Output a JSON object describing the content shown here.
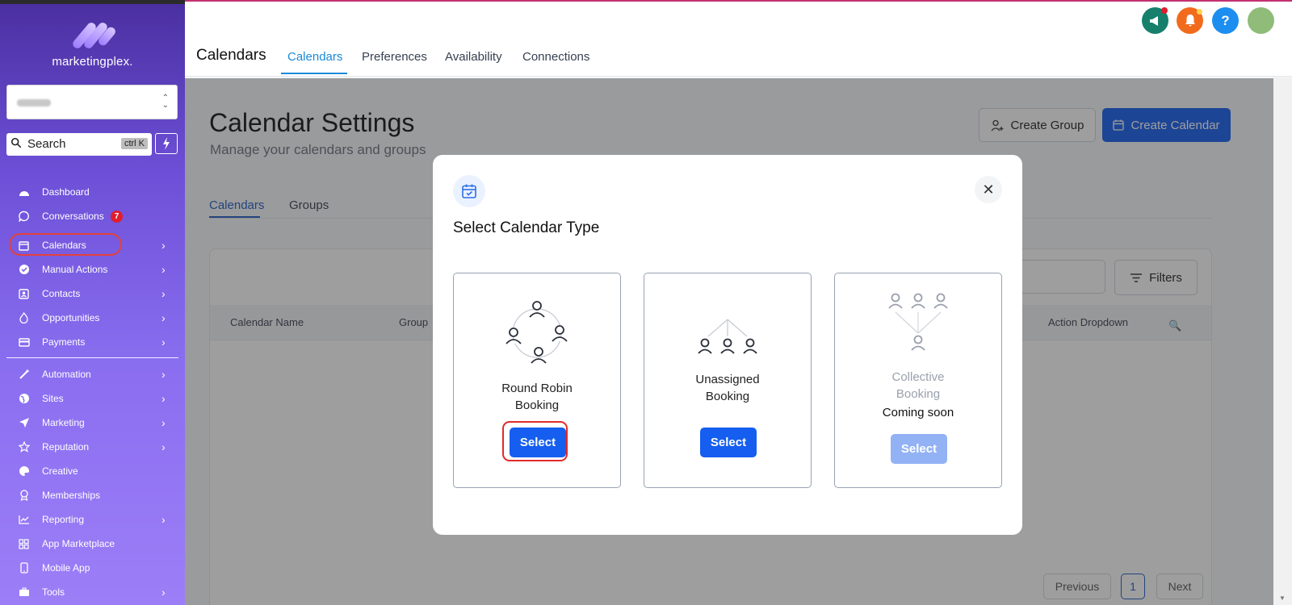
{
  "sidebar": {
    "brand": "marketingplex.",
    "search_label": "Search",
    "search_shortcut": "ctrl K",
    "items": [
      {
        "label": "Dashboard",
        "icon": "dashboard-icon"
      },
      {
        "label": "Conversations",
        "icon": "chat-icon",
        "badge": "7"
      },
      {
        "label": "Calendars",
        "icon": "calendar-icon"
      },
      {
        "label": "Manual Actions",
        "icon": "check-circle-icon"
      },
      {
        "label": "Contacts",
        "icon": "contacts-icon"
      },
      {
        "label": "Opportunities",
        "icon": "flame-icon"
      },
      {
        "label": "Payments",
        "icon": "card-icon"
      },
      {
        "label": "Automation",
        "icon": "wand-icon"
      },
      {
        "label": "Sites",
        "icon": "globe-icon"
      },
      {
        "label": "Marketing",
        "icon": "send-icon"
      },
      {
        "label": "Reputation",
        "icon": "star-icon"
      },
      {
        "label": "Creative",
        "icon": "palette-icon"
      },
      {
        "label": "Memberships",
        "icon": "award-icon"
      },
      {
        "label": "Reporting",
        "icon": "chart-icon"
      },
      {
        "label": "App Marketplace",
        "icon": "grid-icon"
      },
      {
        "label": "Mobile App",
        "icon": "phone-icon"
      },
      {
        "label": "Tools",
        "icon": "toolbox-icon"
      }
    ]
  },
  "topbar": {
    "title": "Calendars",
    "tabs": [
      "Calendars",
      "Preferences",
      "Availability",
      "Connections"
    ],
    "active_tab": "Calendars"
  },
  "main": {
    "title": "Calendar Settings",
    "subtitle": "Manage your calendars and groups",
    "create_group_label": "Create Group",
    "create_calendar_label": "Create Calendar",
    "sub_tabs": [
      "Calendars",
      "Groups"
    ],
    "filters_label": "Filters",
    "columns": [
      "Calendar Name",
      "Group",
      "Action Dropdown"
    ],
    "pager": {
      "previous": "Previous",
      "page": "1",
      "next": "Next"
    }
  },
  "modal": {
    "title": "Select Calendar Type",
    "cards": [
      {
        "name_line1": "Round Robin",
        "name_line2": "Booking",
        "button": "Select",
        "subtitle": ""
      },
      {
        "name_line1": "Unassigned",
        "name_line2": "Booking",
        "button": "Select",
        "subtitle": ""
      },
      {
        "name_line1": "Collective",
        "name_line2": "Booking",
        "button": "Select",
        "subtitle": "Coming soon"
      }
    ]
  },
  "colors": {
    "accent": "#155eef",
    "sidebar_top": "#4a2fa0",
    "sidebar_bottom": "#9c7ef7",
    "badge": "#e11d2e",
    "highlight": "#e22a2a"
  }
}
